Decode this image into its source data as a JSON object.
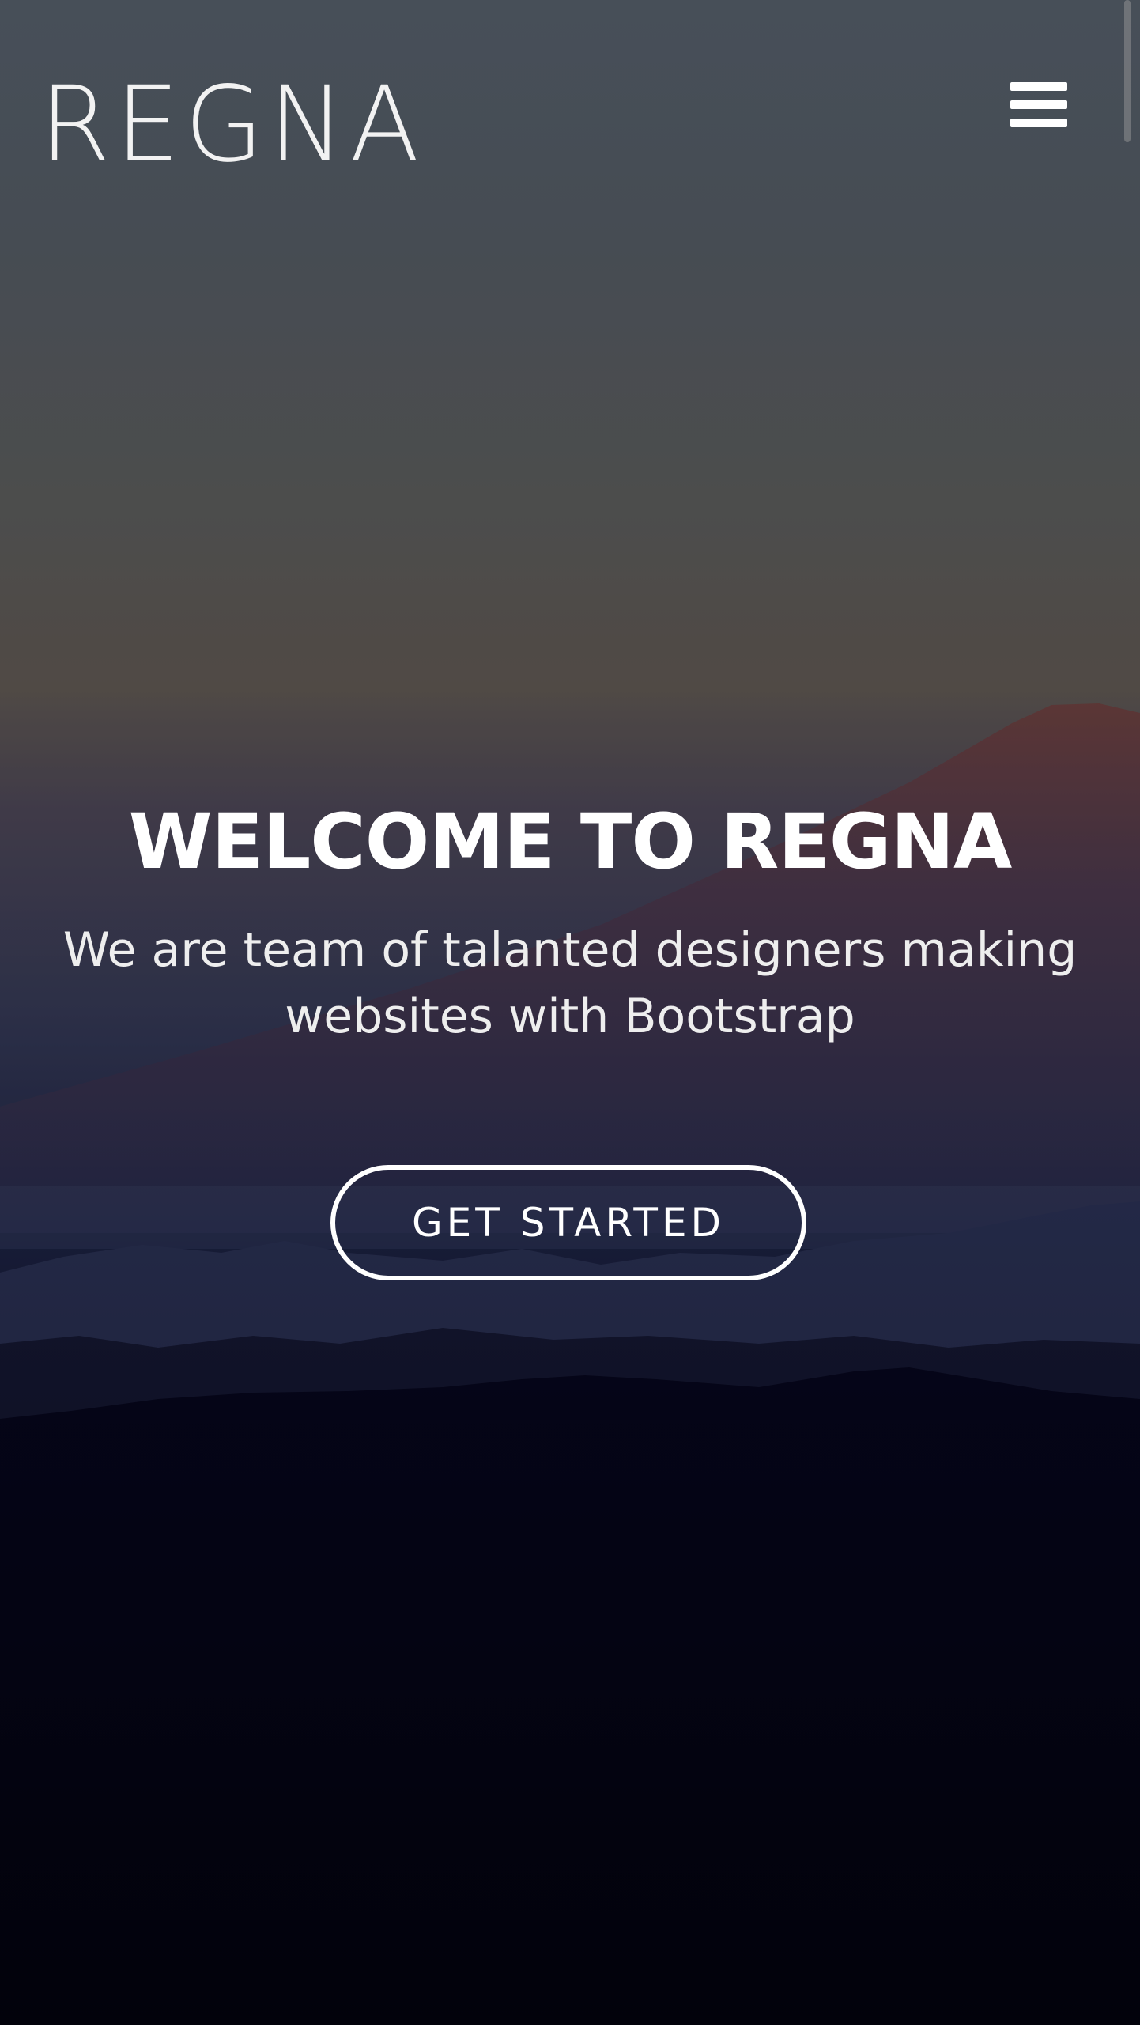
{
  "header": {
    "logo_text": "REGNA",
    "menu_icon": "hamburger-menu-icon"
  },
  "hero": {
    "title": "WELCOME TO REGNA",
    "subtitle": "We are team of talanted designers making websites with Bootstrap",
    "cta_label": "GET STARTED"
  },
  "colors": {
    "text": "#ffffff",
    "sky_top": "#545d66",
    "mountain_glow": "#6a3c3a",
    "foreground": "#04040e"
  }
}
